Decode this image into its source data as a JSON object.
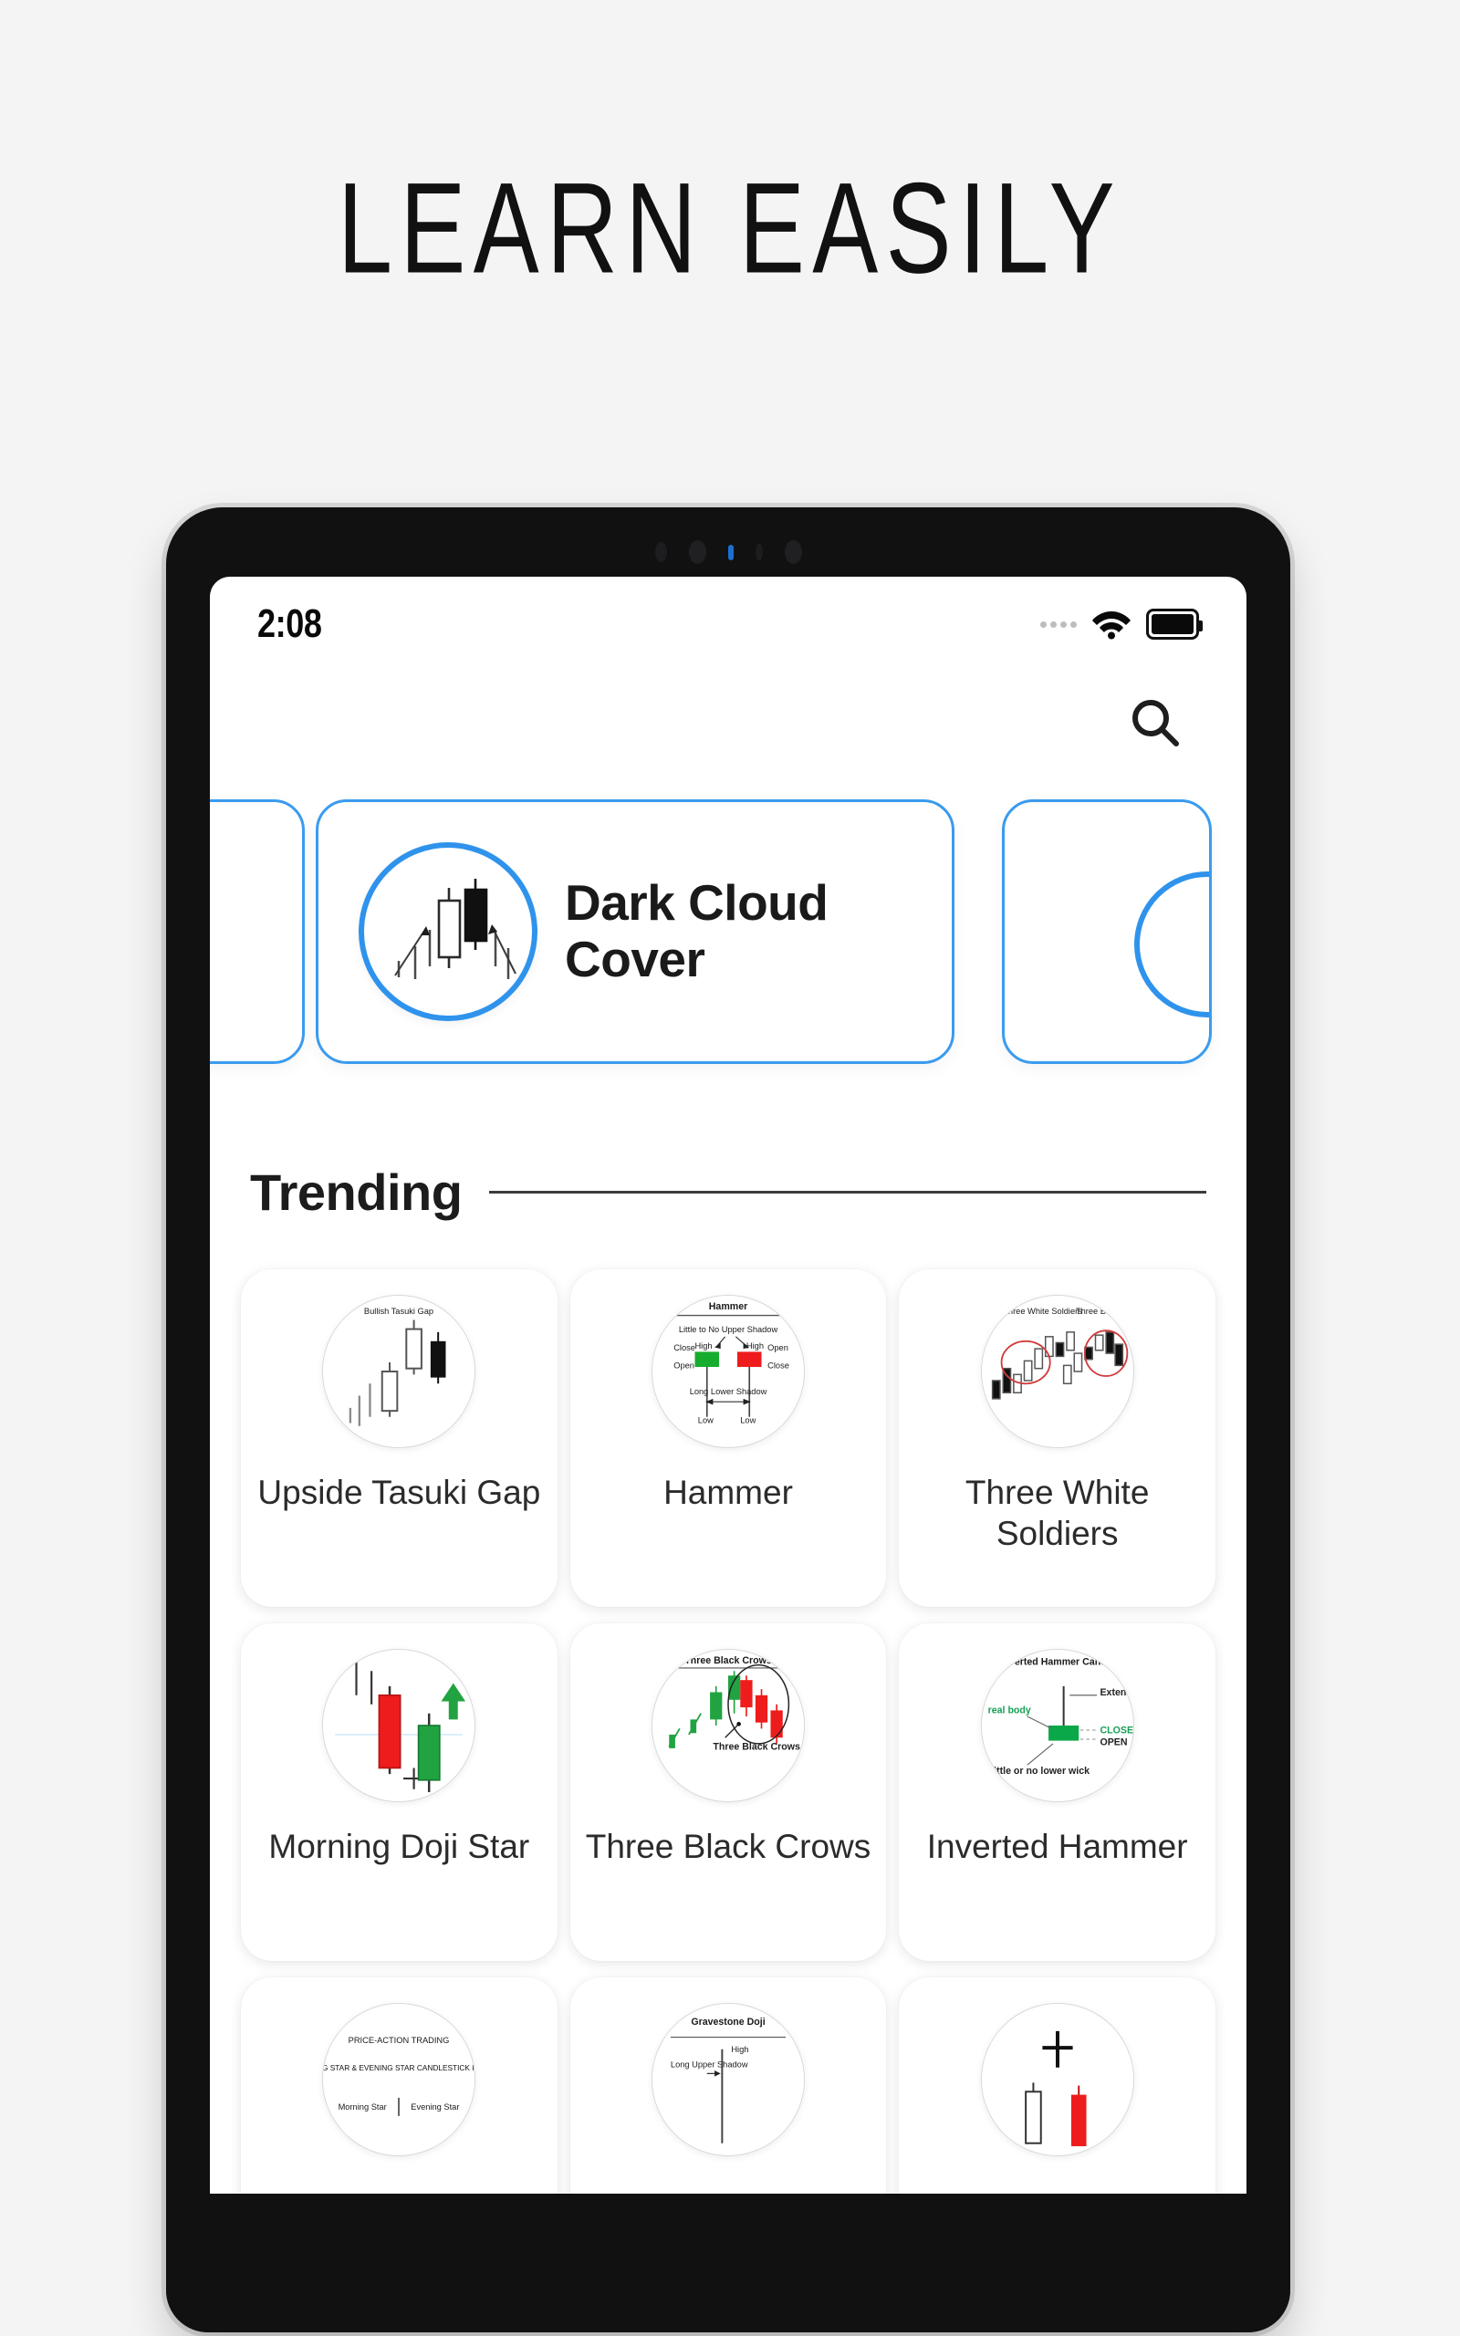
{
  "headline": "LEARN EASILY",
  "statusbar": {
    "time": "2:08",
    "wifi_icon": "wifi-icon",
    "battery_icon": "battery-full-icon",
    "signal_icon": "signal-dots-icon"
  },
  "topbar": {
    "search_icon": "search-icon"
  },
  "featured": {
    "title": "Dark Cloud Cover",
    "accent_color": "#3a9bee",
    "chart_icon": "candlestick-dark-cloud-cover-icon",
    "prev_card_label": "",
    "next_card_label": ""
  },
  "section": {
    "trending_label": "Trending"
  },
  "tiles": [
    {
      "label": "Upside Tasuki Gap",
      "thumb_icon": "bullish-tasuki-gap-diagram-icon",
      "thumb_text": {
        "title": "Bullish Tasuki Gap"
      }
    },
    {
      "label": "Hammer",
      "thumb_icon": "hammer-candlestick-diagram-icon",
      "thumb_text": {
        "title": "Hammer",
        "upper": "Little to No Upper Shadow",
        "left_close": "Close",
        "left_open": "Open",
        "high_left": "High",
        "high_right": "High",
        "right_open": "Open",
        "right_close": "Close",
        "lower": "Long Lower Shadow",
        "low_left": "Low",
        "low_right": "Low"
      }
    },
    {
      "label": "Three White Soldiers",
      "thumb_icon": "three-white-soldiers-diagram-icon",
      "thumb_text": {
        "left": "Three White Soldiers",
        "right": "Three Black Crows"
      }
    },
    {
      "label": "Morning Doji Star",
      "thumb_icon": "morning-doji-star-diagram-icon",
      "thumb_text": {}
    },
    {
      "label": "Three Black Crows",
      "thumb_icon": "three-black-crows-diagram-icon",
      "thumb_text": {
        "title": "Three Black Crows",
        "annotation": "Three Black Crows after Uptrend"
      }
    },
    {
      "label": "Inverted Hammer",
      "thumb_icon": "inverted-hammer-diagram-icon",
      "thumb_text": {
        "title": "Inverted Hammer Candle",
        "wick": "Extended upper wick",
        "close": "CLOSE",
        "open": "OPEN",
        "body": "real body",
        "lower": "Little or no lower wick"
      }
    },
    {
      "label": "",
      "thumb_icon": "morning-evening-star-diagram-icon",
      "thumb_text": {
        "line1": "PRICE-ACTION TRADING",
        "line2": "MORNING STAR & EVENING STAR CANDLESTICK PATTERN",
        "line3a": "Morning Star",
        "line3b": "Evening Star"
      }
    },
    {
      "label": "",
      "thumb_icon": "gravestone-doji-diagram-icon",
      "thumb_text": {
        "title": "Gravestone Doji",
        "shadow": "Long Upper Shadow",
        "high": "High"
      }
    },
    {
      "label": "",
      "thumb_icon": "doji-candles-diagram-icon",
      "thumb_text": {}
    }
  ],
  "colors": {
    "accent": "#3a9bee",
    "bullish": "#22a645",
    "bearish": "#e8262b",
    "page_bg": "#f4f4f4",
    "device_frame": "#111111"
  }
}
